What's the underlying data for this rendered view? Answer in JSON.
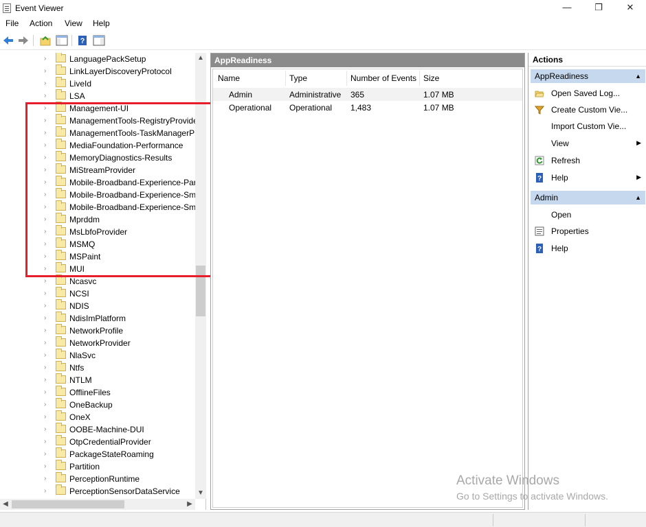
{
  "window": {
    "title": "Event Viewer",
    "minimize_glyph": "—",
    "restore_glyph": "❐",
    "close_glyph": "✕"
  },
  "menu": [
    "File",
    "Action",
    "View",
    "Help"
  ],
  "toolbar": {
    "icons": [
      "back-icon",
      "forward-icon",
      "up-folder-icon",
      "show-hide-tree-icon",
      "help-icon",
      "show-hide-actions-icon"
    ]
  },
  "tree": {
    "items": [
      "LanguagePackSetup",
      "LinkLayerDiscoveryProtocol",
      "LiveId",
      "LSA",
      "Management-UI",
      "ManagementTools-RegistryProvide",
      "ManagementTools-TaskManagerP",
      "MediaFoundation-Performance",
      "MemoryDiagnostics-Results",
      "MiStreamProvider",
      "Mobile-Broadband-Experience-Par",
      "Mobile-Broadband-Experience-Sm",
      "Mobile-Broadband-Experience-Sm",
      "Mprddm",
      "MsLbfoProvider",
      "MSMQ",
      "MSPaint",
      "MUI",
      "Ncasvc",
      "NCSI",
      "NDIS",
      "NdisImPlatform",
      "NetworkProfile",
      "NetworkProvider",
      "NlaSvc",
      "Ntfs",
      "NTLM",
      "OfflineFiles",
      "OneBackup",
      "OneX",
      "OOBE-Machine-DUI",
      "OtpCredentialProvider",
      "PackageStateRoaming",
      "Partition",
      "PerceptionRuntime",
      "PerceptionSensorDataService"
    ]
  },
  "middle": {
    "header": "AppReadiness",
    "columns": [
      "Name",
      "Type",
      "Number of Events",
      "Size"
    ],
    "rows": [
      {
        "name": "Admin",
        "type": "Administrative",
        "events": "365",
        "size": "1.07 MB"
      },
      {
        "name": "Operational",
        "type": "Operational",
        "events": "1,483",
        "size": "1.07 MB"
      }
    ]
  },
  "actions": {
    "title": "Actions",
    "section1": {
      "title": "AppReadiness",
      "items": [
        {
          "label": "Open Saved Log...",
          "icon": "open-folder-icon"
        },
        {
          "label": "Create Custom Vie...",
          "icon": "filter-icon"
        },
        {
          "label": "Import Custom Vie...",
          "icon": ""
        },
        {
          "label": "View",
          "icon": "",
          "submenu": true
        },
        {
          "label": "Refresh",
          "icon": "refresh-icon"
        },
        {
          "label": "Help",
          "icon": "help-icon",
          "submenu": true
        }
      ]
    },
    "section2": {
      "title": "Admin",
      "items": [
        {
          "label": "Open",
          "icon": ""
        },
        {
          "label": "Properties",
          "icon": "properties-icon"
        },
        {
          "label": "Help",
          "icon": "help-icon"
        }
      ]
    }
  },
  "watermark": {
    "title": "Activate Windows",
    "subtitle": "Go to Settings to activate Windows."
  },
  "colors": {
    "highlight": "#e81d2c",
    "pane_header": "#8b8b8b",
    "section_header": "#c5d8ee"
  }
}
